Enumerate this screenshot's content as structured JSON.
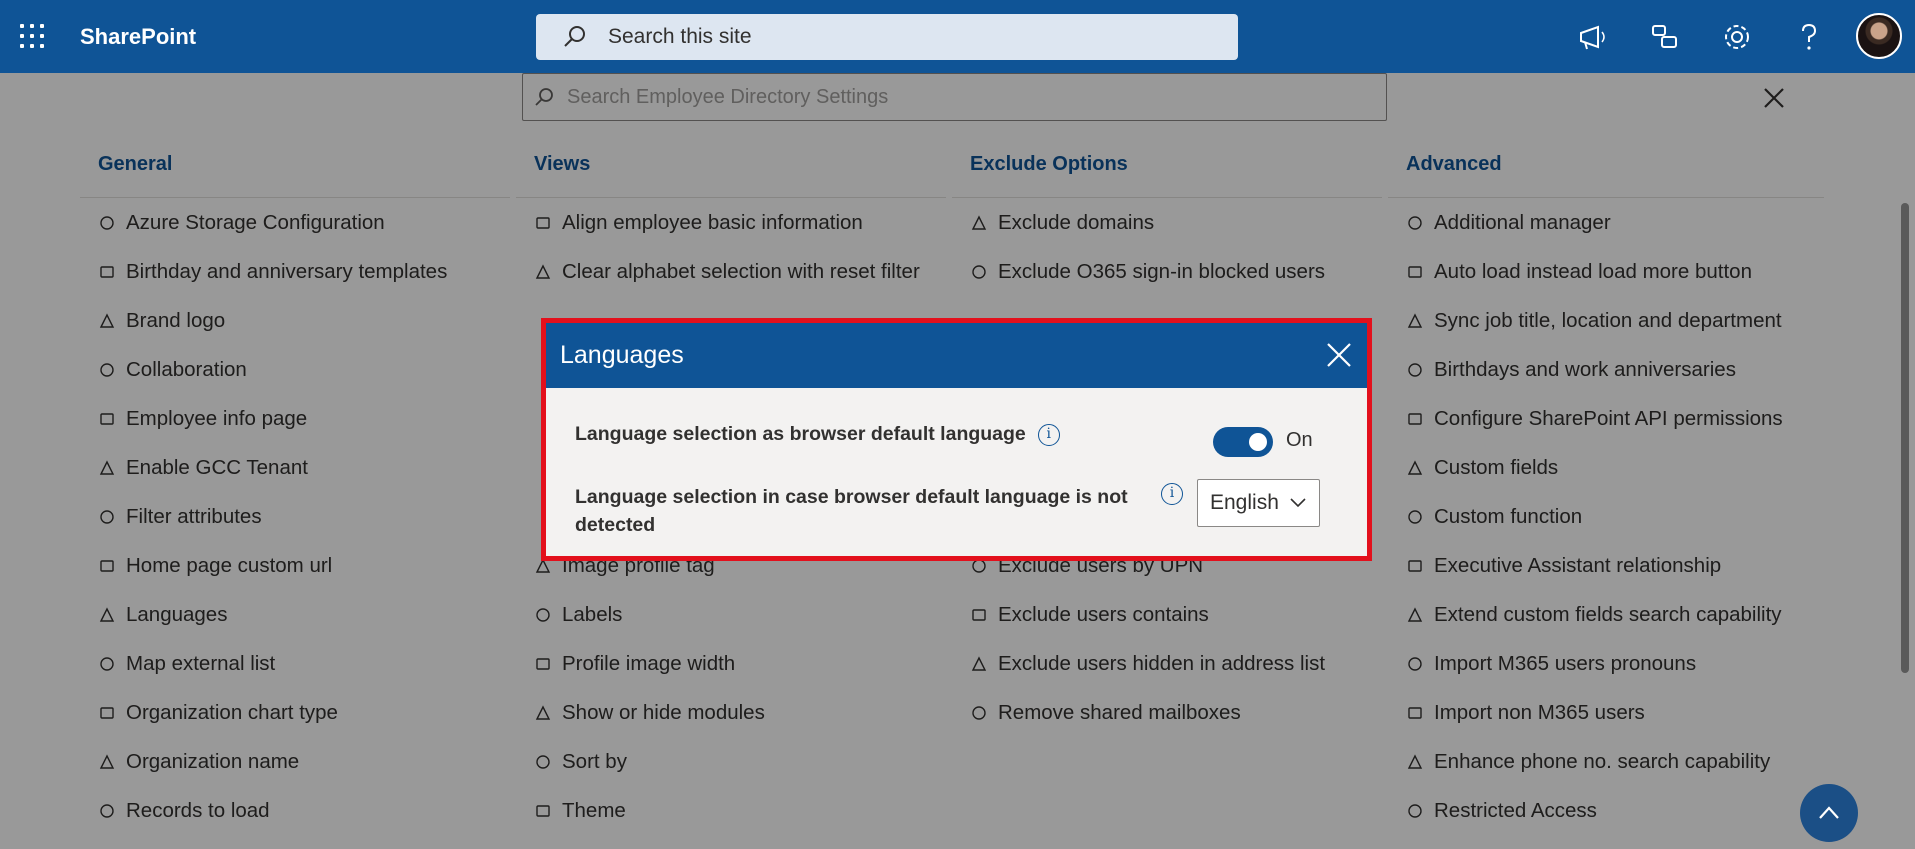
{
  "suitebar": {
    "brand": "SharePoint",
    "search_placeholder": "Search this site"
  },
  "settings_search": {
    "placeholder": "Search Employee Directory Settings"
  },
  "columns": [
    {
      "heading": "General",
      "items": [
        "Azure Storage Configuration",
        "Birthday and anniversary templates",
        "Brand logo",
        "Collaboration",
        "Employee info page",
        "Enable GCC Tenant",
        "Filter attributes",
        "Home page custom url",
        "Languages",
        "Map external list",
        "Organization chart type",
        "Organization name",
        "Records to load"
      ]
    },
    {
      "heading": "Views",
      "items": [
        "Align employee basic information",
        "Clear alphabet selection with reset filter",
        "",
        "",
        "",
        "",
        "",
        "Image profile tag",
        "Labels",
        "Profile image width",
        "Show or hide modules",
        "Sort by",
        "Theme"
      ]
    },
    {
      "heading": "Exclude Options",
      "items": [
        "Exclude domains",
        "Exclude O365 sign-in blocked users",
        "",
        "",
        "",
        "",
        "",
        "Exclude users by UPN",
        "Exclude users contains",
        "Exclude users hidden in address list",
        "Remove shared mailboxes",
        "",
        ""
      ]
    },
    {
      "heading": "Advanced",
      "items": [
        "Additional manager",
        "Auto load instead load more button",
        "Sync job title, location and department",
        "Birthdays and work anniversaries",
        "Configure SharePoint API permissions",
        "Custom fields",
        "Custom function",
        "Executive Assistant relationship",
        "Extend custom fields search capability",
        "Import M365 users pronouns",
        "Import non M365 users",
        "Enhance phone no. search capability",
        "Restricted Access"
      ]
    }
  ],
  "dialog": {
    "title": "Languages",
    "row1_label": "Language selection as browser default language",
    "toggle_state": "On",
    "row2_label": "Language selection in case browser default language is not detected",
    "select_value": "English"
  },
  "colors": {
    "brand": "#0f5496",
    "highlight": "#e3101c"
  }
}
